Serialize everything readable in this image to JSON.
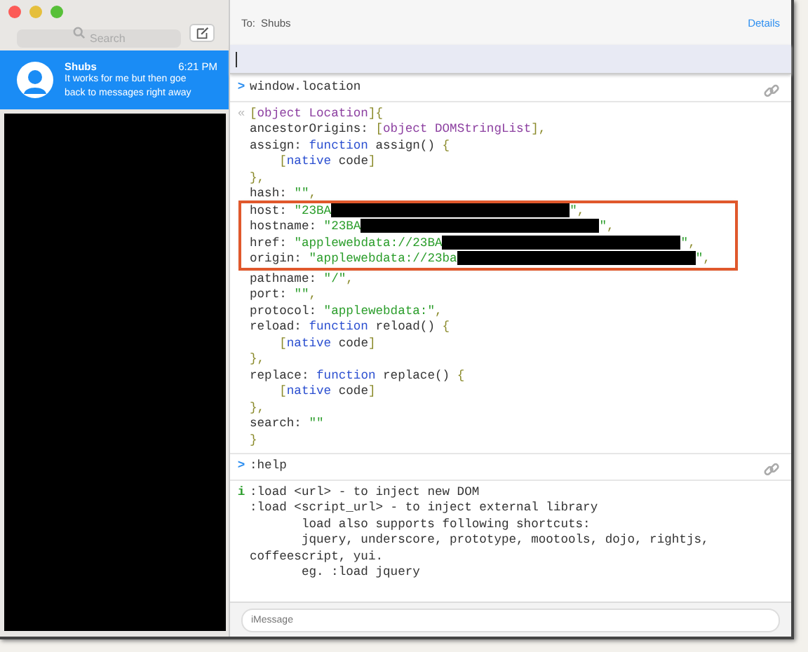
{
  "sidebar": {
    "search": {
      "placeholder": "Search"
    },
    "conversations": [
      {
        "name": "Shubs",
        "time": "6:21 PM",
        "preview": [
          "It works for me but then goe",
          "back to messages right away"
        ],
        "selected": true
      }
    ]
  },
  "header": {
    "to_label": "To:",
    "recipient": "Shubs",
    "details": "Details"
  },
  "console": {
    "entries": [
      {
        "kind": "input",
        "prompt": ">",
        "lines": [
          {
            "segments": [
              {
                "text": "window.location",
                "kind": "plain"
              }
            ]
          }
        ]
      },
      {
        "kind": "result",
        "prompt": "«",
        "blocks": [
          {
            "boxed": false,
            "lines": [
              {
                "segments": [
                  {
                    "text": "[",
                    "kind": "punct"
                  },
                  {
                    "text": "object Location",
                    "kind": "type"
                  },
                  {
                    "text": "]{",
                    "kind": "punct"
                  }
                ]
              },
              {
                "segments": [
                  {
                    "text": "ancestorOrigins: ",
                    "kind": "plain"
                  },
                  {
                    "text": "[",
                    "kind": "punct"
                  },
                  {
                    "text": "object DOMStringList",
                    "kind": "type"
                  },
                  {
                    "text": "],",
                    "kind": "punct"
                  }
                ]
              },
              {
                "segments": [
                  {
                    "text": "assign: ",
                    "kind": "plain"
                  },
                  {
                    "text": "function",
                    "kind": "keyword"
                  },
                  {
                    "text": " assign() ",
                    "kind": "plain"
                  },
                  {
                    "text": "{",
                    "kind": "punct"
                  }
                ],
                "children": [
                  {
                    "segments": [
                      {
                        "text": "[",
                        "kind": "punct"
                      },
                      {
                        "text": "native",
                        "kind": "keyword"
                      },
                      {
                        "text": " code",
                        "kind": "plain"
                      },
                      {
                        "text": "]",
                        "kind": "punct"
                      }
                    ]
                  }
                ]
              },
              {
                "segments": [
                  {
                    "text": "},",
                    "kind": "punct"
                  }
                ]
              },
              {
                "segments": [
                  {
                    "text": "hash: ",
                    "kind": "plain"
                  },
                  {
                    "text": "\"\"",
                    "kind": "string"
                  },
                  {
                    "text": ",",
                    "kind": "punct"
                  }
                ]
              }
            ]
          },
          {
            "boxed": true,
            "lines": [
              {
                "segments": [
                  {
                    "text": "host: ",
                    "kind": "plain"
                  },
                  {
                    "text": "\"23BA",
                    "kind": "string"
                  },
                  {
                    "kind": "redacted"
                  },
                  {
                    "text": "\"",
                    "kind": "string"
                  },
                  {
                    "text": ",",
                    "kind": "punct"
                  }
                ]
              },
              {
                "segments": [
                  {
                    "text": "hostname: ",
                    "kind": "plain"
                  },
                  {
                    "text": "\"23BA",
                    "kind": "string"
                  },
                  {
                    "kind": "redacted"
                  },
                  {
                    "text": "\"",
                    "kind": "string"
                  },
                  {
                    "text": ",",
                    "kind": "punct"
                  }
                ]
              },
              {
                "segments": [
                  {
                    "text": "href: ",
                    "kind": "plain"
                  },
                  {
                    "text": "\"applewebdata://23BA",
                    "kind": "string"
                  },
                  {
                    "kind": "redacted"
                  },
                  {
                    "text": "\"",
                    "kind": "string"
                  },
                  {
                    "text": ",",
                    "kind": "punct"
                  }
                ]
              },
              {
                "segments": [
                  {
                    "text": "origin: ",
                    "kind": "plain"
                  },
                  {
                    "text": "\"applewebdata://23ba",
                    "kind": "string"
                  },
                  {
                    "kind": "redacted"
                  },
                  {
                    "text": "\"",
                    "kind": "string"
                  },
                  {
                    "text": ",",
                    "kind": "punct"
                  }
                ]
              }
            ]
          },
          {
            "boxed": false,
            "lines": [
              {
                "segments": [
                  {
                    "text": "pathname: ",
                    "kind": "plain"
                  },
                  {
                    "text": "\"/\"",
                    "kind": "string"
                  },
                  {
                    "text": ",",
                    "kind": "punct"
                  }
                ]
              },
              {
                "segments": [
                  {
                    "text": "port: ",
                    "kind": "plain"
                  },
                  {
                    "text": "\"\"",
                    "kind": "string"
                  },
                  {
                    "text": ",",
                    "kind": "punct"
                  }
                ]
              },
              {
                "segments": [
                  {
                    "text": "protocol: ",
                    "kind": "plain"
                  },
                  {
                    "text": "\"applewebdata:\"",
                    "kind": "string"
                  },
                  {
                    "text": ",",
                    "kind": "punct"
                  }
                ]
              },
              {
                "segments": [
                  {
                    "text": "reload: ",
                    "kind": "plain"
                  },
                  {
                    "text": "function",
                    "kind": "keyword"
                  },
                  {
                    "text": " reload() ",
                    "kind": "plain"
                  },
                  {
                    "text": "{",
                    "kind": "punct"
                  }
                ],
                "children": [
                  {
                    "segments": [
                      {
                        "text": "[",
                        "kind": "punct"
                      },
                      {
                        "text": "native",
                        "kind": "keyword"
                      },
                      {
                        "text": " code",
                        "kind": "plain"
                      },
                      {
                        "text": "]",
                        "kind": "punct"
                      }
                    ]
                  }
                ]
              },
              {
                "segments": [
                  {
                    "text": "},",
                    "kind": "punct"
                  }
                ]
              },
              {
                "segments": [
                  {
                    "text": "replace: ",
                    "kind": "plain"
                  },
                  {
                    "text": "function",
                    "kind": "keyword"
                  },
                  {
                    "text": " replace() ",
                    "kind": "plain"
                  },
                  {
                    "text": "{",
                    "kind": "punct"
                  }
                ],
                "children": [
                  {
                    "segments": [
                      {
                        "text": "[",
                        "kind": "punct"
                      },
                      {
                        "text": "native",
                        "kind": "keyword"
                      },
                      {
                        "text": " code",
                        "kind": "plain"
                      },
                      {
                        "text": "]",
                        "kind": "punct"
                      }
                    ]
                  }
                ]
              },
              {
                "segments": [
                  {
                    "text": "},",
                    "kind": "punct"
                  }
                ]
              },
              {
                "segments": [
                  {
                    "text": "search: ",
                    "kind": "plain"
                  },
                  {
                    "text": "\"\"",
                    "kind": "string"
                  }
                ]
              },
              {
                "segments": [
                  {
                    "text": "}",
                    "kind": "punct"
                  }
                ]
              }
            ]
          }
        ]
      },
      {
        "kind": "input",
        "prompt": ">",
        "lines": [
          {
            "segments": [
              {
                "text": ":help",
                "kind": "plain"
              }
            ]
          }
        ]
      },
      {
        "kind": "info",
        "prompt": "i",
        "lines": [
          {
            "segments": [
              {
                "text": ":load <url> - to inject new DOM",
                "kind": "plain"
              }
            ]
          },
          {
            "segments": [
              {
                "text": ":load <script_url> - to inject external library",
                "kind": "plain"
              }
            ],
            "children": [
              {
                "segments": [
                  {
                    "text": "load also supports following shortcuts:",
                    "kind": "plain"
                  }
                ]
              },
              {
                "segments": [
                  {
                    "text": "jquery, underscore, prototype, mootools, dojo, rightjs,",
                    "kind": "plain"
                  }
                ]
              }
            ]
          },
          {
            "segments": [
              {
                "text": "coffeescript, yui.",
                "kind": "plain"
              }
            ],
            "children": [
              {
                "segments": [
                  {
                    "text": "eg. :load jquery",
                    "kind": "plain"
                  }
                ]
              }
            ]
          }
        ]
      }
    ]
  },
  "composer": {
    "placeholder": "iMessage"
  }
}
